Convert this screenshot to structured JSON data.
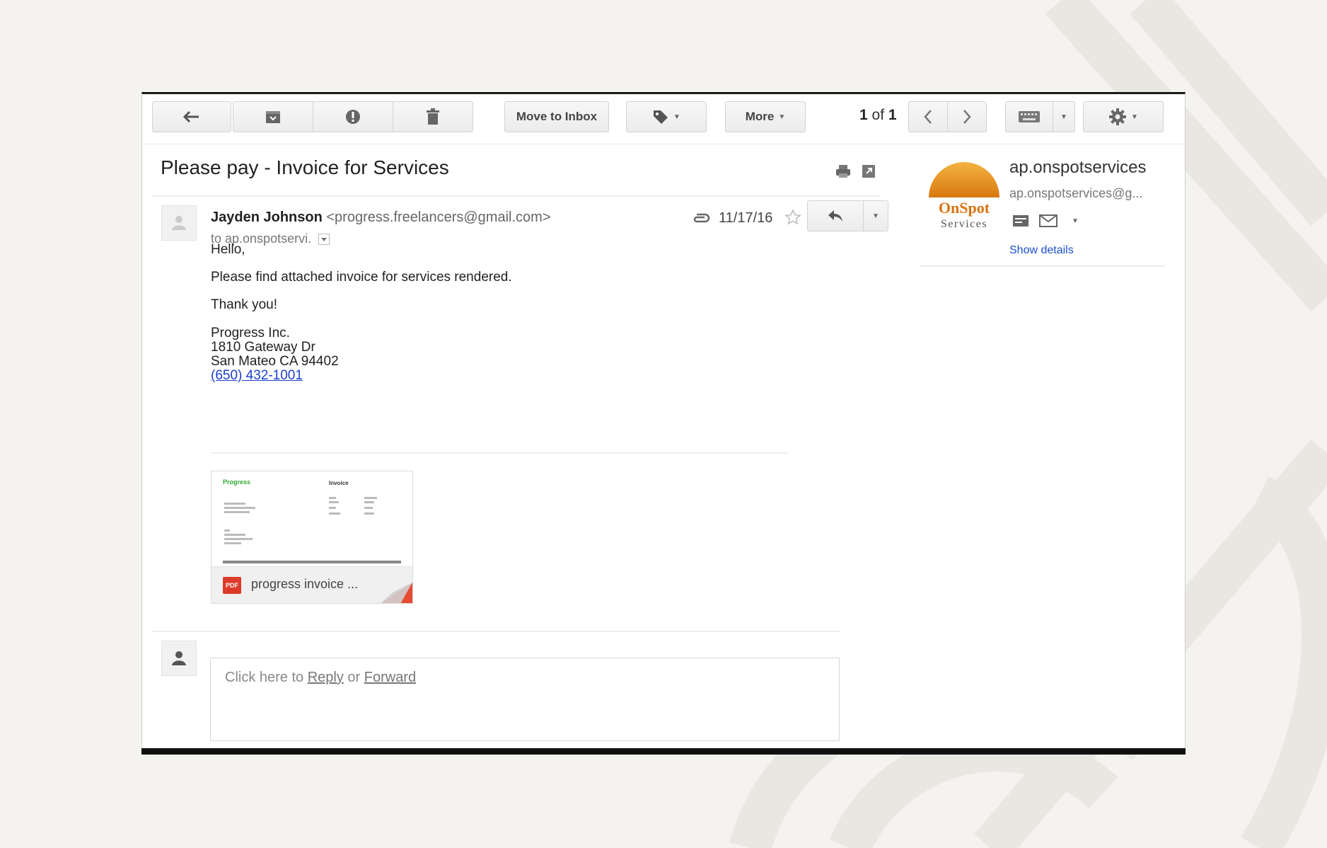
{
  "toolbar": {
    "move_to_inbox_label": "Move to Inbox",
    "more_label": "More",
    "pager_current": "1",
    "pager_of": "of",
    "pager_total": "1"
  },
  "email": {
    "subject": "Please pay - Invoice for Services",
    "sender_name": "Jayden Johnson",
    "sender_email": "<progress.freelancers@gmail.com>",
    "to_line": "to ap.onspotservi.",
    "date": "11/17/16",
    "body": {
      "greeting": "Hello,",
      "line1": "Please find attached invoice for services rendered.",
      "thanks": "Thank you!",
      "company": "Progress Inc.",
      "address1": "1810 Gateway Dr",
      "address2": "San Mateo CA 94402",
      "phone": "(650) 432-1001"
    },
    "attachment": {
      "name": "progress invoice ...",
      "type_badge": "PDF",
      "thumb_brand": "Progress",
      "thumb_title": "Invoice"
    }
  },
  "reply_box": {
    "prefix": "Click here to",
    "reply_link": "Reply",
    "or_text": "or",
    "forward_link": "Forward"
  },
  "contact": {
    "name": "ap.onspotservices",
    "email": "ap.onspotservices@g...",
    "show_details": "Show details",
    "logo_line1": "OnSpot",
    "logo_line2": "Services",
    "logo_orange": "#e8961c"
  }
}
